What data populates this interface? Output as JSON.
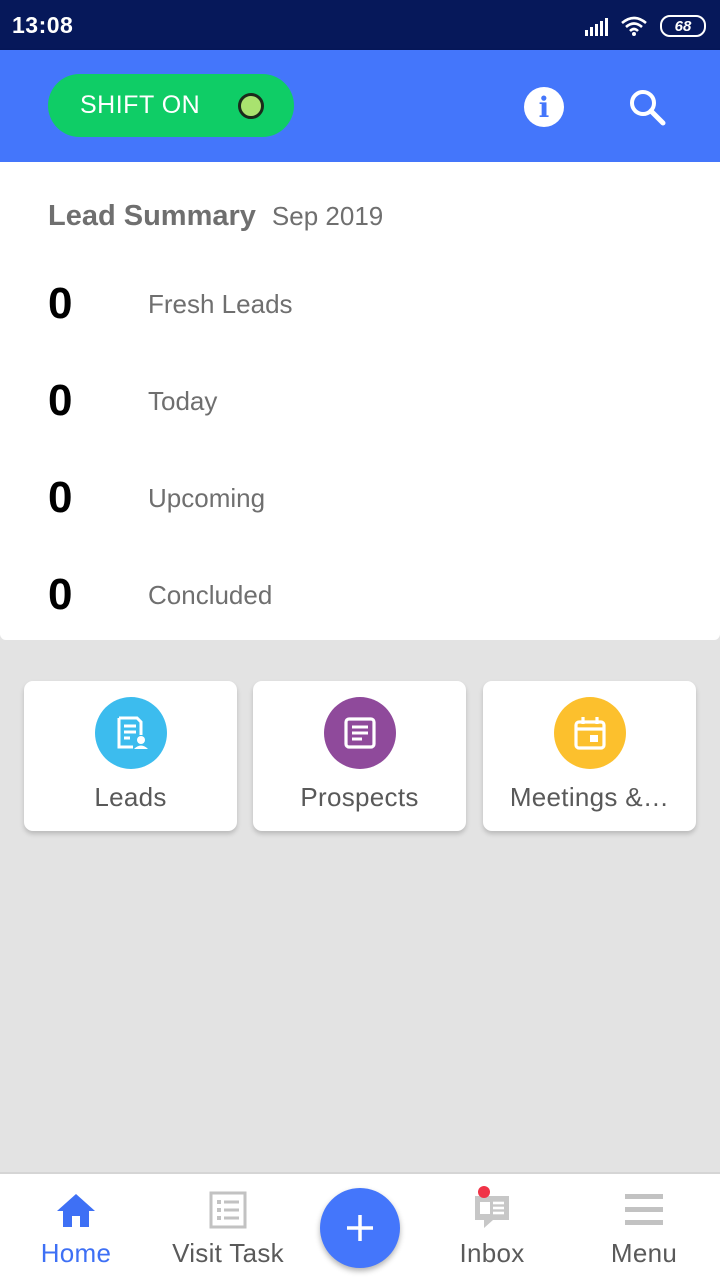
{
  "status_bar": {
    "time": "13:08",
    "battery": "68"
  },
  "app_bar": {
    "shift_label": "SHIFT ON",
    "icons": {
      "info": "info-icon",
      "search": "search-icon"
    }
  },
  "summary": {
    "title": "Lead Summary",
    "period": "Sep 2019",
    "rows": [
      {
        "count": "0",
        "label": "Fresh Leads"
      },
      {
        "count": "0",
        "label": "Today"
      },
      {
        "count": "0",
        "label": "Upcoming"
      },
      {
        "count": "0",
        "label": "Concluded"
      }
    ]
  },
  "tiles": [
    {
      "label": "Leads",
      "icon": "lead-card-icon",
      "color": "#3cbcee"
    },
    {
      "label": "Prospects",
      "icon": "document-icon",
      "color": "#8f4a9b"
    },
    {
      "label": "Meetings &…",
      "icon": "calendar-icon",
      "color": "#fcc02d"
    }
  ],
  "bottom_nav": {
    "items": [
      {
        "label": "Home",
        "icon": "home-icon",
        "active": true
      },
      {
        "label": "Visit Task",
        "icon": "task-list-icon",
        "active": false
      },
      {
        "label": "Inbox",
        "icon": "inbox-icon",
        "active": false,
        "badge": true
      },
      {
        "label": "Menu",
        "icon": "menu-icon",
        "active": false
      }
    ],
    "fab_icon": "plus-icon"
  },
  "colors": {
    "status_bar": "#06185a",
    "app_bar": "#4476fb",
    "shift_on": "#0fcd66",
    "active_nav": "#3e70f5",
    "badge": "#f03347"
  }
}
